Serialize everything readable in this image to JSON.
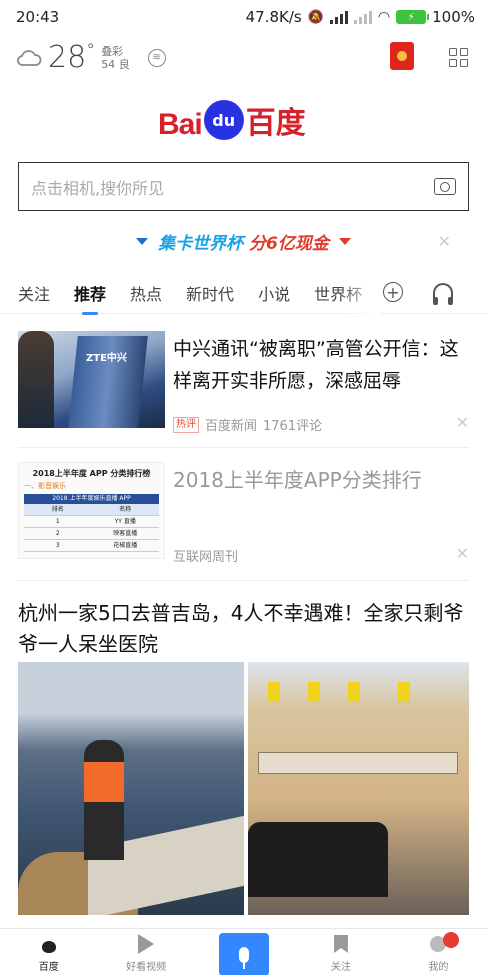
{
  "status_bar": {
    "time": "20:43",
    "speed": "47.8K/s",
    "battery": "100%"
  },
  "weather": {
    "temperature": "28",
    "degree": "°",
    "condition": "叠彩",
    "aqi_value": "54",
    "aqi_level": "良"
  },
  "logo": {
    "latin": "Bai",
    "badge": "du",
    "chinese": "百度"
  },
  "search": {
    "placeholder": "点击相机,搜你所见"
  },
  "banner": {
    "part1": "集卡世界杯 ",
    "part2": "分6亿现金"
  },
  "tabs": [
    {
      "label": "关注"
    },
    {
      "label": "推荐"
    },
    {
      "label": "热点"
    },
    {
      "label": "新时代"
    },
    {
      "label": "小说"
    },
    {
      "label": "世界杯"
    }
  ],
  "feed": {
    "item1": {
      "title": "中兴通讯“被离职”高管公开信：这样离开实非所愿，深感屈辱",
      "tag": "热评",
      "source": "百度新闻",
      "comments": "1761评论",
      "thumb_text": "ZTE中兴"
    },
    "item2": {
      "title": "2018上半年度APP分类排行",
      "source": "互联网周刊",
      "thumb_title": "2018上半年度 APP 分类排行榜",
      "thumb_sub": "一、影音娱乐",
      "thumb_bar": "2018 上半年度娱乐直播 APP",
      "thumb_head_rank": "排名",
      "thumb_head_name": "名称",
      "thumb_rows": [
        {
          "rank": "1",
          "name": "YY 直播"
        },
        {
          "rank": "2",
          "name": "映客直播"
        },
        {
          "rank": "3",
          "name": "花椒直播"
        }
      ]
    },
    "item3": {
      "title": "杭州一家5口去普吉岛，4人不幸遇难！全家只剩爷爷一人呆坐医院"
    }
  },
  "bottom_nav": [
    {
      "label": "百度"
    },
    {
      "label": "好看视频"
    },
    {
      "label": ""
    },
    {
      "label": "关注"
    },
    {
      "label": "我的"
    }
  ],
  "colors": {
    "accent": "#3388ff",
    "brand_red": "#d6212a",
    "brand_blue": "#2932e1"
  }
}
